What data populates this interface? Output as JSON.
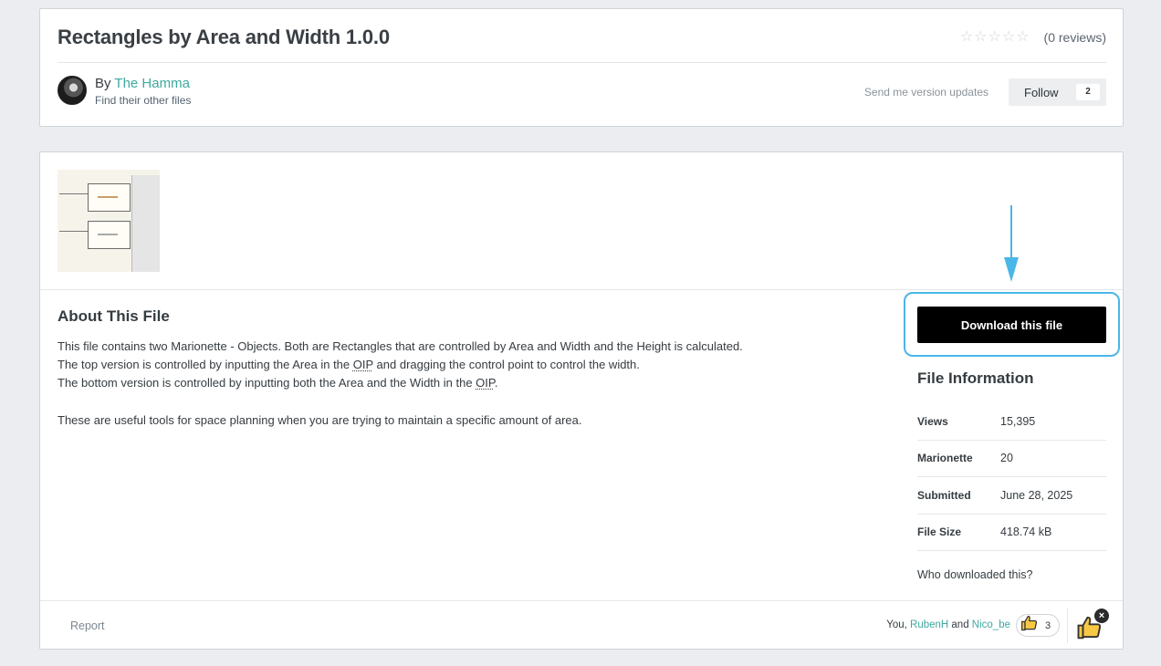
{
  "header": {
    "title": "Rectangles by Area and Width 1.0.0",
    "stars": [
      "☆",
      "☆",
      "☆",
      "☆",
      "☆"
    ],
    "reviews_label": "(0 reviews)",
    "by_prefix": "By",
    "author": "The Hamma",
    "other_files_link": "Find their other files",
    "send_updates": "Send me version updates",
    "follow_label": "Follow",
    "follow_count": "2"
  },
  "about": {
    "title": "About This File",
    "line1": "This file contains two Marionette - Objects. Both are Rectangles that are controlled by Area and Width and the Height is calculated.",
    "line2_pre": "The top version is controlled by inputting the Area in the ",
    "line2_abbr": "OIP",
    "line2_post": " and dragging the control point to control the width.",
    "line3_pre": "The bottom version is controlled by inputting both the Area and the Width in the ",
    "line3_abbr": "OIP",
    "line3_post": ".",
    "line4": "These are useful tools for space planning when you are trying to maintain a specific amount of area."
  },
  "download": {
    "button_label": "Download this file"
  },
  "file_info": {
    "title": "File Information",
    "rows": [
      {
        "key": "Views",
        "value": "15,395"
      },
      {
        "key": "Marionette",
        "value": "20"
      },
      {
        "key": "Submitted",
        "value": "June 28, 2025"
      },
      {
        "key": "File Size",
        "value": "418.74 kB"
      }
    ],
    "who_downloaded": "Who downloaded this?"
  },
  "footer": {
    "report": "Report",
    "likers_prefix": "You, ",
    "liker1": "RubenH",
    "likers_and": " and ",
    "liker2": "Nico_be",
    "like_count": "3",
    "close_glyph": "×"
  },
  "colors": {
    "accent_link": "#3ea9a0",
    "highlight": "#4bb6e8",
    "download_bg": "#000000"
  },
  "icons": [
    "star-icon",
    "thumbs-up-icon",
    "close-icon",
    "arrow-down-icon"
  ]
}
